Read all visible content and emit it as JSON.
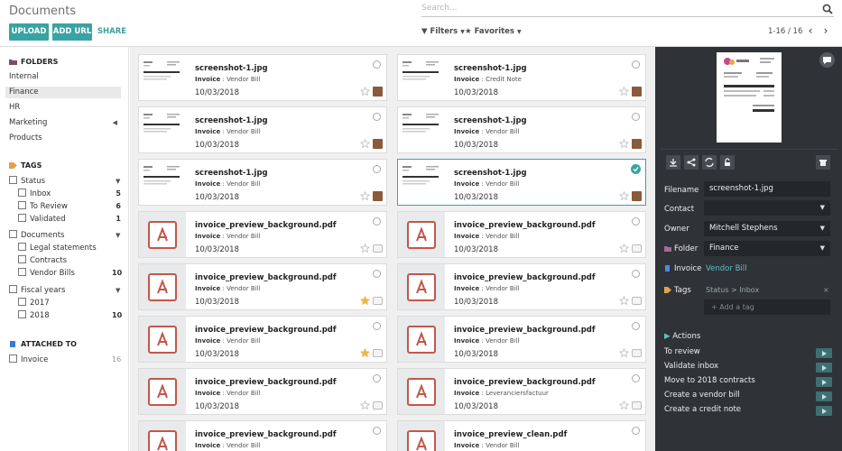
{
  "header": {
    "title": "Documents",
    "upload_label": "UPLOAD",
    "add_url_label": "ADD URL",
    "share_label": "SHARE",
    "search_placeholder": "Search...",
    "filters_label": "Filters",
    "favorites_label": "Favorites",
    "pager": "1-16 / 16"
  },
  "colors": {
    "accent": "#39a3a3",
    "panel": "#2f3237",
    "pdf": "#c0584a"
  },
  "sidebar": {
    "folders_title": "FOLDERS",
    "folders": [
      "Internal",
      "Finance",
      "HR",
      "Marketing",
      "Products"
    ],
    "tags_title": "TAGS",
    "status_group": "Status",
    "status_items": [
      {
        "label": "Inbox",
        "count": "5"
      },
      {
        "label": "To Review",
        "count": "6"
      },
      {
        "label": "Validated",
        "count": "1"
      }
    ],
    "documents_group": "Documents",
    "documents_items": [
      {
        "label": "Legal statements",
        "count": ""
      },
      {
        "label": "Contracts",
        "count": ""
      },
      {
        "label": "Vendor Bills",
        "count": "10"
      }
    ],
    "fiscal_group": "Fiscal years",
    "fiscal_items": [
      {
        "label": "2017",
        "count": ""
      },
      {
        "label": "2018",
        "count": "10"
      }
    ],
    "attached_title": "ATTACHED TO",
    "attached_items": [
      {
        "label": "Invoice",
        "count": "16"
      }
    ]
  },
  "cards": [
    {
      "name": "screenshot-1.jpg",
      "type": "Invoice",
      "detail": "Vendor Bill",
      "date": "10/03/2018"
    },
    {
      "name": "screenshot-1.jpg",
      "type": "Invoice",
      "detail": "Credit Note",
      "date": "10/03/2018"
    },
    {
      "name": "screenshot-1.jpg",
      "type": "Invoice",
      "detail": "Vendor Bill",
      "date": "10/03/2018"
    },
    {
      "name": "screenshot-1.jpg",
      "type": "Invoice",
      "detail": "Vendor Bill",
      "date": "10/03/2018"
    },
    {
      "name": "screenshot-1.jpg",
      "type": "Invoice",
      "detail": "Vendor Bill",
      "date": "10/03/2018"
    },
    {
      "name": "screenshot-1.jpg",
      "type": "Invoice",
      "detail": "Vendor Bill",
      "date": "10/03/2018"
    },
    {
      "name": "invoice_preview_background.pdf",
      "type": "Invoice",
      "detail": "Vendor Bill",
      "date": "10/03/2018"
    },
    {
      "name": "invoice_preview_background.pdf",
      "type": "Invoice",
      "detail": "Vendor Bill",
      "date": "10/03/2018"
    },
    {
      "name": "invoice_preview_background.pdf",
      "type": "Invoice",
      "detail": "Vendor Bill",
      "date": "10/03/2018"
    },
    {
      "name": "invoice_preview_background.pdf",
      "type": "Invoice",
      "detail": "Vendor Bill",
      "date": "10/03/2018"
    },
    {
      "name": "invoice_preview_background.pdf",
      "type": "Invoice",
      "detail": "Vendor Bill",
      "date": "10/03/2018"
    },
    {
      "name": "invoice_preview_background.pdf",
      "type": "Invoice",
      "detail": "Vendor Bill",
      "date": "10/03/2018"
    },
    {
      "name": "invoice_preview_background.pdf",
      "type": "Invoice",
      "detail": "Vendor Bill",
      "date": "10/03/2018"
    },
    {
      "name": "invoice_preview_background.pdf",
      "type": "Invoice",
      "detail": "Leveranciersfactuur",
      "date": "10/03/2018"
    },
    {
      "name": "invoice_preview_background.pdf",
      "type": "Invoice",
      "detail": "Vendor Bill",
      "date": ""
    },
    {
      "name": "invoice_preview_clean.pdf",
      "type": "Invoice",
      "detail": "Vendor Bill",
      "date": ""
    }
  ],
  "details": {
    "filename_label": "Filename",
    "filename": "screenshot-1.jpg",
    "contact_label": "Contact",
    "contact": "",
    "owner_label": "Owner",
    "owner": "Mitchell Stephens",
    "folder_label": "Folder",
    "folder": "Finance",
    "invoice_label": "Invoice",
    "invoice_link": "Vendor Bill",
    "tags_label": "Tags",
    "tag": "Status > Inbox",
    "tag_remove": "×",
    "add_tag_placeholder": "+ Add a tag",
    "actions_title": "Actions",
    "actions": [
      "To review",
      "Validate inbox",
      "Move to 2018 contracts",
      "Create a vendor bill",
      "Create a credit note"
    ]
  }
}
